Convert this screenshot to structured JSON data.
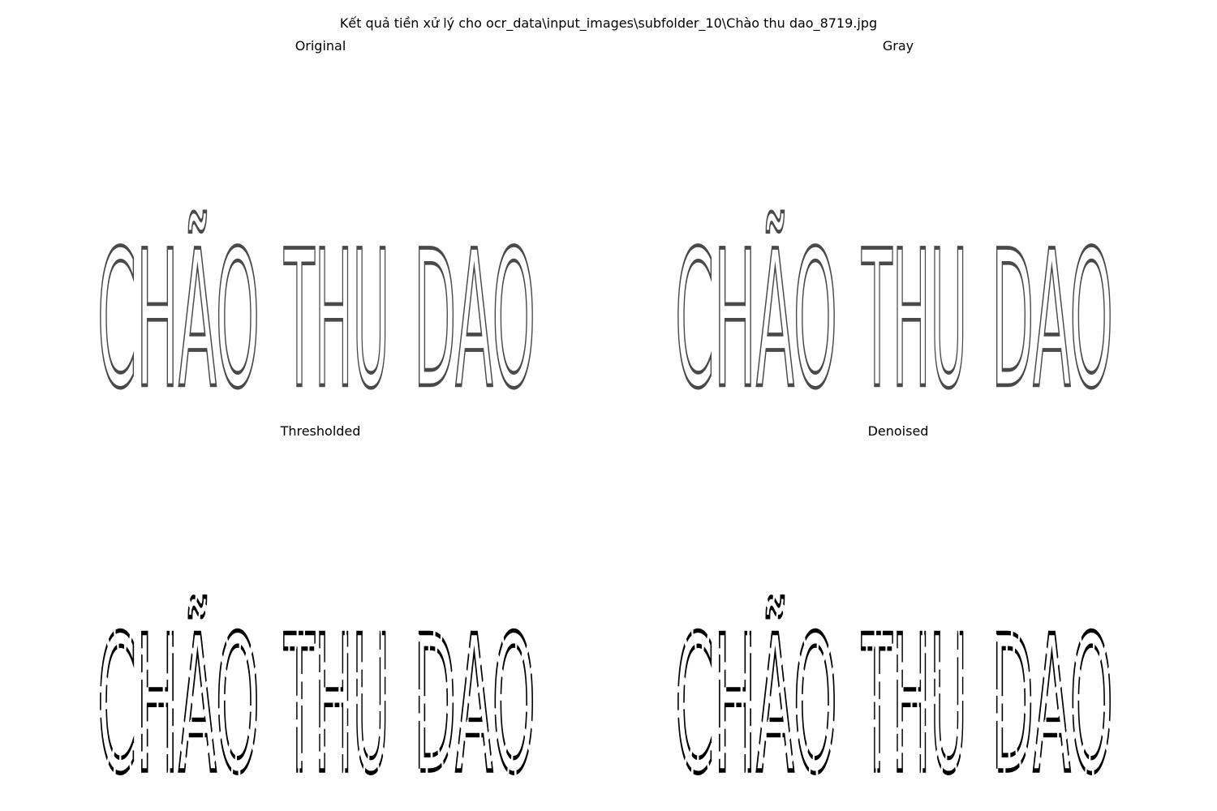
{
  "figure": {
    "suptitle": "Kết quả tiền xử lý cho ocr_data\\input_images\\subfolder_10\\Chào thu dao_8719.jpg"
  },
  "panels": [
    {
      "title": "Original",
      "image_text": "CHÃO THU DAO",
      "style": "soft"
    },
    {
      "title": "Gray",
      "image_text": "CHÃO THU DAO",
      "style": "soft"
    },
    {
      "title": "Thresholded",
      "image_text": "CHÃO THU DAO",
      "style": "binary"
    },
    {
      "title": "Denoised",
      "image_text": "CHÃO THU DAO",
      "style": "binary"
    }
  ]
}
